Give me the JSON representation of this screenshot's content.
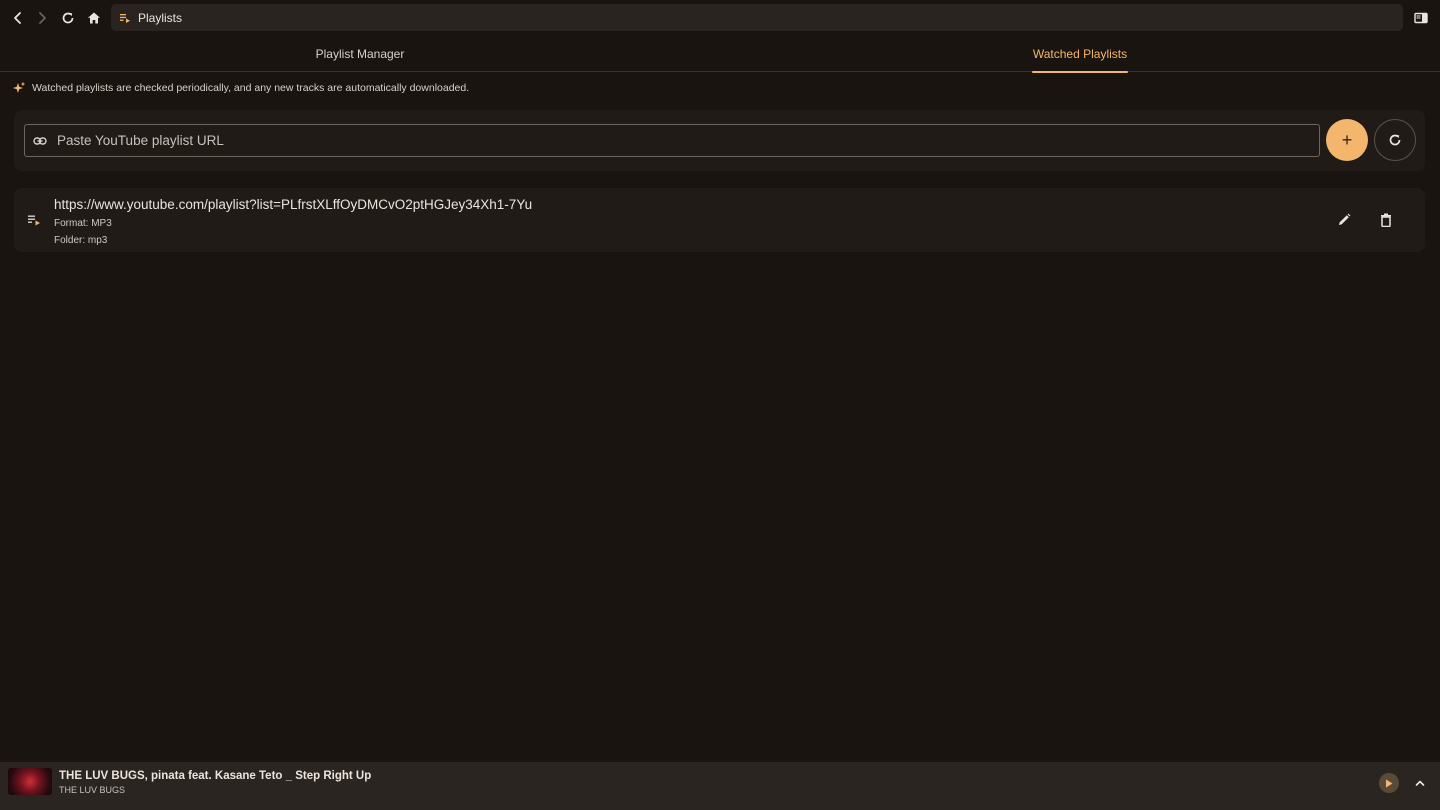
{
  "address_bar": {
    "page_title": "Playlists",
    "icon": "playlist-play-icon"
  },
  "nav": {
    "back_icon": "chevron-left-icon",
    "forward_icon": "chevron-right-icon",
    "reload_icon": "reload-icon",
    "home_icon": "home-icon",
    "sidebar_icon": "sidebar-toggle-icon"
  },
  "tabs": [
    {
      "label": "Playlist Manager",
      "active": false
    },
    {
      "label": "Watched Playlists",
      "active": true
    }
  ],
  "info": {
    "text": "Watched playlists are checked periodically, and any new tracks are automatically downloaded.",
    "icon": "sparkles-icon"
  },
  "url_input": {
    "placeholder": "Paste YouTube playlist URL",
    "value": "",
    "icon": "link-icon"
  },
  "buttons": {
    "add_label": "+",
    "add_icon": "plus-icon",
    "refresh_icon": "refresh-icon"
  },
  "watched_playlists": [
    {
      "url": "https://www.youtube.com/playlist?list=PLfrstXLffOyDMCvO2ptHGJey34Xh1-7Yu",
      "format": "Format: MP3",
      "folder": "Folder: mp3",
      "icon": "playlist-play-icon",
      "edit_icon": "pencil-icon",
      "delete_icon": "trash-icon"
    }
  ],
  "player": {
    "title": "THE LUV BUGS, pinata feat. Kasane Teto _ Step Right Up",
    "artist": "THE LUV BUGS",
    "play_icon": "play-icon",
    "expand_icon": "chevron-up-icon"
  },
  "colors": {
    "background": "#1a1411",
    "accent": "#f4b66c",
    "card": "#211b17",
    "player_bar": "#2b2521"
  }
}
